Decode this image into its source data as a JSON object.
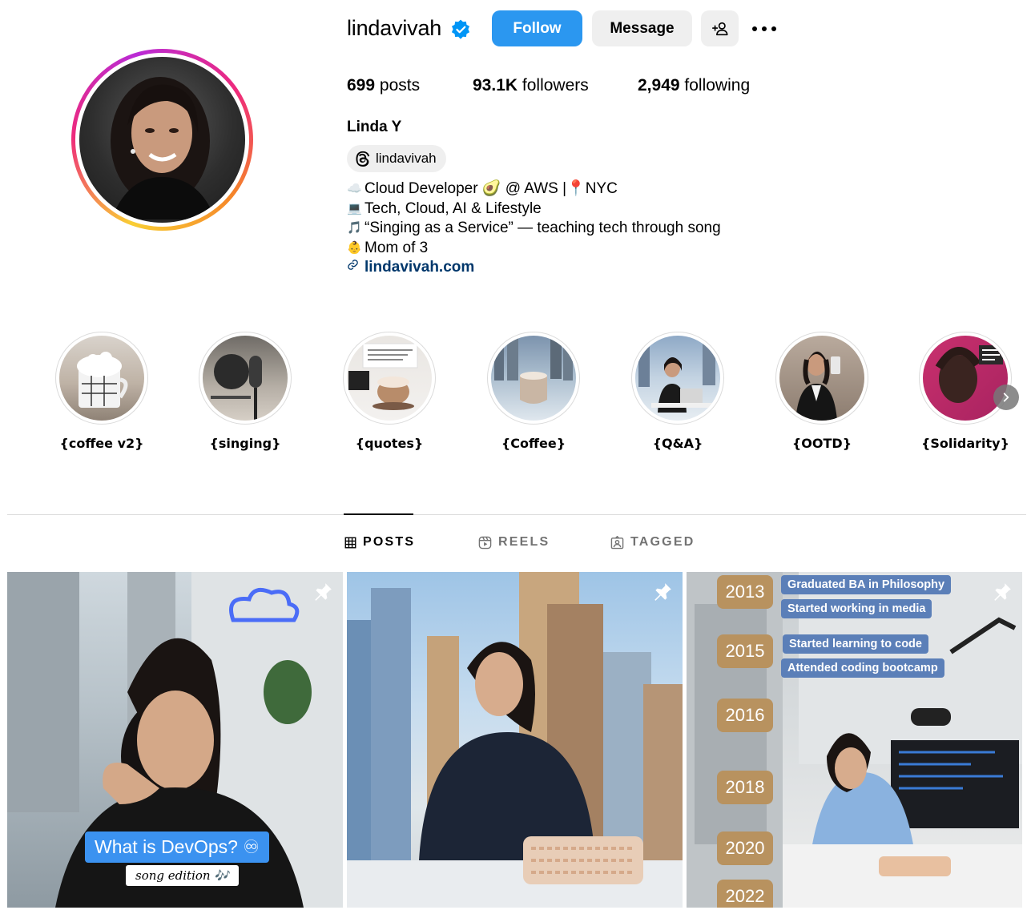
{
  "profile": {
    "username": "lindavivah",
    "full_name": "Linda Y",
    "threads_handle": "lindavivah",
    "verified": true
  },
  "actions": {
    "follow_label": "Follow",
    "message_label": "Message",
    "suggest_icon": "add-person-icon",
    "more_icon": "more-options-icon"
  },
  "stats": {
    "posts_count": "699",
    "posts_label": "posts",
    "followers_count": "93.1K",
    "followers_label": "followers",
    "following_count": "2,949",
    "following_label": "following"
  },
  "bio": {
    "lines": [
      {
        "emoji": "☁️",
        "text": "Cloud Developer 🥑 @ AWS |📍NYC"
      },
      {
        "emoji": "💻",
        "text": "Tech, Cloud, AI & Lifestyle"
      },
      {
        "emoji": "🎵",
        "text": "“Singing as a Service” — teaching tech through song"
      },
      {
        "emoji": "👶",
        "text": "Mom of 3"
      }
    ],
    "link_icon": "link-icon",
    "link": "lindavivah.com"
  },
  "highlights": [
    {
      "label": "{coffee v2}"
    },
    {
      "label": "{singing}"
    },
    {
      "label": "{quotes}"
    },
    {
      "label": "{Coffee}"
    },
    {
      "label": "{Q&A}"
    },
    {
      "label": "{OOTD}"
    },
    {
      "label": "{Solidarity}"
    }
  ],
  "tabs": [
    {
      "label": "POSTS",
      "icon": "grid-icon",
      "active": true
    },
    {
      "label": "REELS",
      "icon": "reels-icon",
      "active": false
    },
    {
      "label": "TAGGED",
      "icon": "tagged-icon",
      "active": false
    }
  ],
  "posts": [
    {
      "pinned": true,
      "title": "What is DevOps? ♾",
      "subtitle": "song edition 🎶"
    },
    {
      "pinned": true
    },
    {
      "pinned": true,
      "timeline": [
        {
          "year": "2013",
          "events": [
            "Graduated BA in Philosophy",
            "Started working in media"
          ]
        },
        {
          "year": "2015",
          "events": [
            "Started learning to code",
            "Attended coding bootcamp"
          ]
        },
        {
          "year": "2016",
          "events": []
        },
        {
          "year": "2018",
          "events": []
        },
        {
          "year": "2020",
          "events": []
        },
        {
          "year": "2022",
          "events": []
        }
      ]
    }
  ],
  "colors": {
    "follow_button": "#2b97f0",
    "verified_badge": "#0095f6",
    "link": "#00376b",
    "timeline_year": "#b8925f",
    "timeline_event": "#5b7fb8"
  }
}
